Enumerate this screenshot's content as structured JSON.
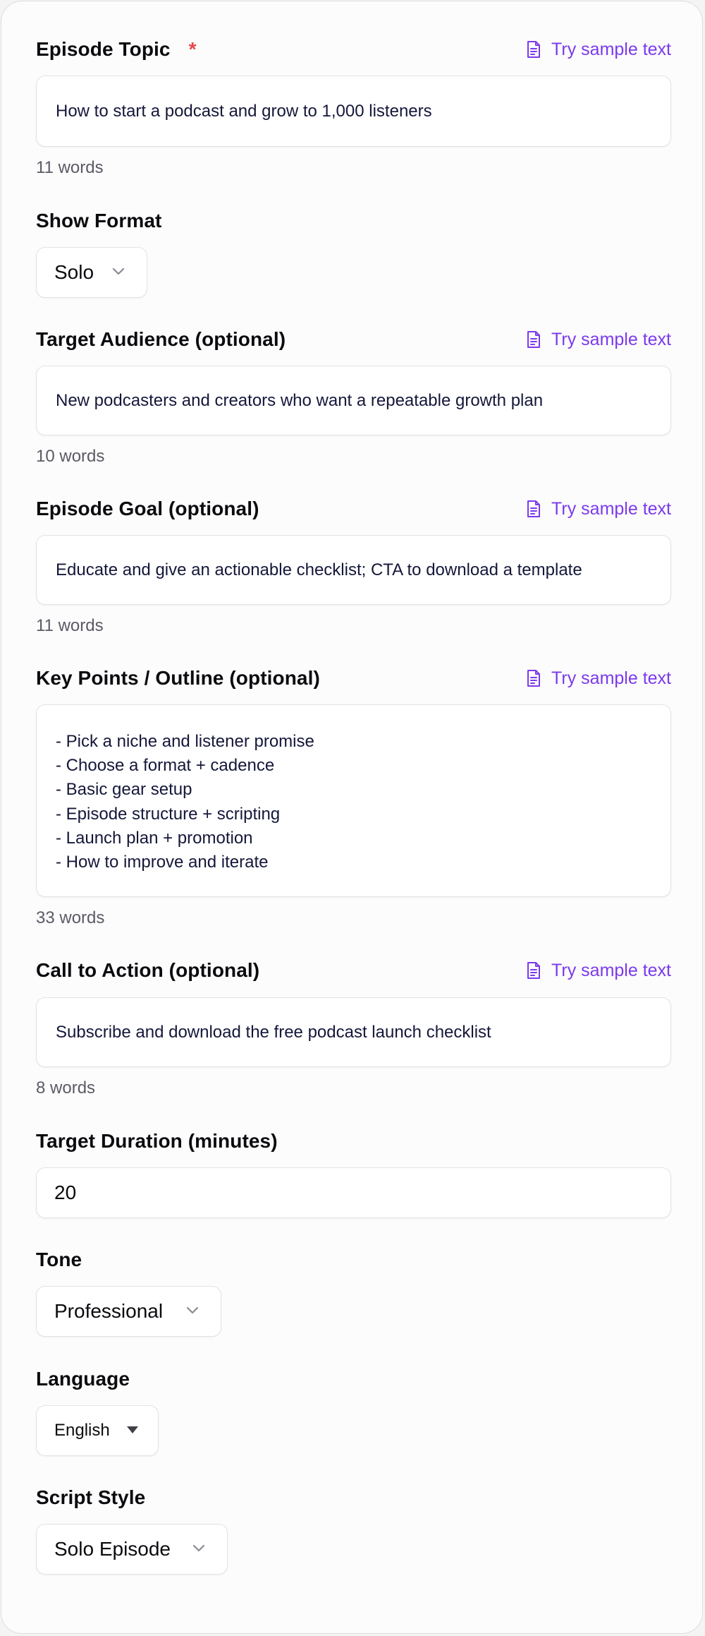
{
  "episode_topic": {
    "label": "Episode Topic",
    "required_mark": "*",
    "sample_label": "Try sample text",
    "value": "How to start a podcast and grow to 1,000 listeners",
    "word_count": "11 words"
  },
  "show_format": {
    "label": "Show Format",
    "value": "Solo"
  },
  "target_audience": {
    "label": "Target Audience (optional)",
    "sample_label": "Try sample text",
    "value": "New podcasters and creators who want a repeatable growth plan",
    "word_count": "10 words"
  },
  "episode_goal": {
    "label": "Episode Goal (optional)",
    "sample_label": "Try sample text",
    "value": "Educate and give an actionable checklist; CTA to download a template",
    "word_count": "11 words"
  },
  "key_points": {
    "label": "Key Points / Outline (optional)",
    "sample_label": "Try sample text",
    "lines": [
      "- Pick a niche and listener promise",
      "- Choose a format + cadence",
      "- Basic gear setup",
      "- Episode structure + scripting",
      "- Launch plan + promotion",
      "- How to improve and iterate"
    ],
    "word_count": "33 words"
  },
  "call_to_action": {
    "label": "Call to Action (optional)",
    "sample_label": "Try sample text",
    "value": "Subscribe and download the free podcast launch checklist",
    "word_count": "8 words"
  },
  "target_duration": {
    "label": "Target Duration (minutes)",
    "value": "20"
  },
  "tone": {
    "label": "Tone",
    "value": "Professional"
  },
  "language": {
    "label": "Language",
    "value": "English"
  },
  "script_style": {
    "label": "Script Style",
    "value": "Solo Episode"
  },
  "colors": {
    "accent": "#7c3aed",
    "required": "#e5484d",
    "text": "#0b0b0f",
    "input_text": "#15173a",
    "muted": "#5b5b66",
    "border": "#e3e3e7"
  },
  "icons": {
    "sample": "document-lines-icon",
    "chevron": "chevron-down-icon",
    "caret": "caret-down-icon"
  }
}
